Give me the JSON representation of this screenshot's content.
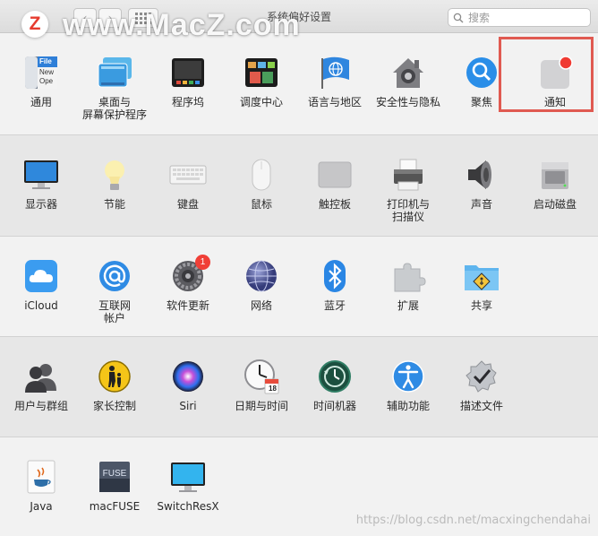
{
  "window": {
    "title": "系统偏好设置"
  },
  "watermark": {
    "text": "www.MacZ.com",
    "logo_letter": "Z"
  },
  "toolbar": {
    "back_symbol": "‹",
    "forward_symbol": "›"
  },
  "search": {
    "placeholder": "搜索"
  },
  "sections": [
    [
      {
        "name": "general",
        "label": "通用",
        "icon": "general-icon"
      },
      {
        "name": "desktop-screensaver",
        "label": "桌面与\n屏幕保护程序",
        "icon": "desktop-icon"
      },
      {
        "name": "dock",
        "label": "程序坞",
        "icon": "dock-icon"
      },
      {
        "name": "mission-control",
        "label": "调度中心",
        "icon": "mission-control-icon"
      },
      {
        "name": "language-region",
        "label": "语言与地区",
        "icon": "globe-flag-icon"
      },
      {
        "name": "security-privacy",
        "label": "安全性与隐私",
        "icon": "house-lock-icon"
      },
      {
        "name": "spotlight",
        "label": "聚焦",
        "icon": "magnifier-icon"
      },
      {
        "name": "notifications",
        "label": "通知",
        "icon": "notification-icon"
      }
    ],
    [
      {
        "name": "displays",
        "label": "显示器",
        "icon": "display-icon"
      },
      {
        "name": "energy-saver",
        "label": "节能",
        "icon": "bulb-icon"
      },
      {
        "name": "keyboard",
        "label": "键盘",
        "icon": "keyboard-icon"
      },
      {
        "name": "mouse",
        "label": "鼠标",
        "icon": "mouse-icon"
      },
      {
        "name": "trackpad",
        "label": "触控板",
        "icon": "trackpad-icon"
      },
      {
        "name": "printers-scanners",
        "label": "打印机与\n扫描仪",
        "icon": "printer-icon"
      },
      {
        "name": "sound",
        "label": "声音",
        "icon": "speaker-icon"
      },
      {
        "name": "startup-disk",
        "label": "启动磁盘",
        "icon": "disk-icon"
      }
    ],
    [
      {
        "name": "icloud",
        "label": "iCloud",
        "icon": "cloud-icon"
      },
      {
        "name": "internet-accounts",
        "label": "互联网\n帐户",
        "icon": "at-icon"
      },
      {
        "name": "software-update",
        "label": "软件更新",
        "icon": "gear-icon",
        "badge": "1"
      },
      {
        "name": "network",
        "label": "网络",
        "icon": "network-globe-icon"
      },
      {
        "name": "bluetooth",
        "label": "蓝牙",
        "icon": "bluetooth-icon"
      },
      {
        "name": "extensions",
        "label": "扩展",
        "icon": "puzzle-icon"
      },
      {
        "name": "sharing",
        "label": "共享",
        "icon": "folder-share-icon"
      }
    ],
    [
      {
        "name": "users-groups",
        "label": "用户与群组",
        "icon": "users-icon"
      },
      {
        "name": "parental-controls",
        "label": "家长控制",
        "icon": "family-icon"
      },
      {
        "name": "siri",
        "label": "Siri",
        "icon": "siri-icon"
      },
      {
        "name": "date-time",
        "label": "日期与时间",
        "icon": "clock-calendar-icon",
        "calendar_day": "18"
      },
      {
        "name": "time-machine",
        "label": "时间机器",
        "icon": "time-machine-icon"
      },
      {
        "name": "accessibility",
        "label": "辅助功能",
        "icon": "accessibility-icon"
      },
      {
        "name": "profiles",
        "label": "描述文件",
        "icon": "check-badge-icon"
      }
    ],
    [
      {
        "name": "java",
        "label": "Java",
        "icon": "java-icon"
      },
      {
        "name": "macfuse",
        "label": "macFUSE",
        "icon": "fuse-icon",
        "icon_text": "FUSE"
      },
      {
        "name": "switchresx",
        "label": "SwitchResX",
        "icon": "monitor-icon"
      }
    ]
  ],
  "general_icon": {
    "lines": [
      "File",
      "New",
      "Ope"
    ]
  },
  "site_mark": "https://blog.csdn.net/macxingchendahai"
}
